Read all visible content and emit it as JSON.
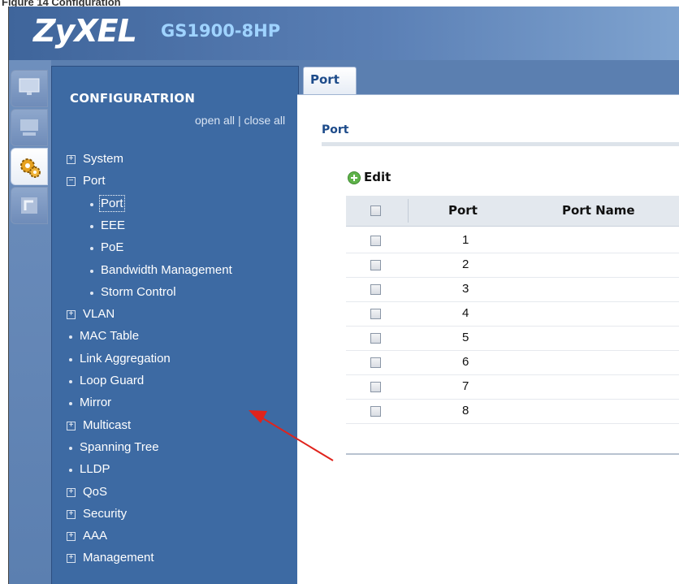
{
  "caption": "Figure 14 Configuration",
  "header": {
    "brand": "ZyXEL",
    "model": "GS1900-8HP"
  },
  "icon_bar": [
    "monitor-icon",
    "status-icon",
    "configuration-gears-icon",
    "maintenance-icon"
  ],
  "sidebar": {
    "title": "CONFIGURATRION",
    "open_all": "open all",
    "divider": "|",
    "close_all": "close all",
    "items": [
      {
        "label": "System",
        "marker": "plus",
        "level": 0
      },
      {
        "label": "Port",
        "marker": "minus",
        "level": 0
      },
      {
        "label": "Port",
        "marker": "dot",
        "level": 1,
        "selected": true
      },
      {
        "label": "EEE",
        "marker": "dot",
        "level": 1
      },
      {
        "label": "PoE",
        "marker": "dot",
        "level": 1
      },
      {
        "label": "Bandwidth Management",
        "marker": "dot",
        "level": 1
      },
      {
        "label": "Storm Control",
        "marker": "dot",
        "level": 1
      },
      {
        "label": "VLAN",
        "marker": "plus",
        "level": 0
      },
      {
        "label": "MAC Table",
        "marker": "dot",
        "level": 0
      },
      {
        "label": "Link Aggregation",
        "marker": "dot",
        "level": 0
      },
      {
        "label": "Loop Guard",
        "marker": "dot",
        "level": 0
      },
      {
        "label": "Mirror",
        "marker": "dot",
        "level": 0
      },
      {
        "label": "Multicast",
        "marker": "plus",
        "level": 0
      },
      {
        "label": "Spanning Tree",
        "marker": "dot",
        "level": 0
      },
      {
        "label": "LLDP",
        "marker": "dot",
        "level": 0
      },
      {
        "label": "QoS",
        "marker": "plus",
        "level": 0
      },
      {
        "label": "Security",
        "marker": "plus",
        "level": 0
      },
      {
        "label": "AAA",
        "marker": "plus",
        "level": 0
      },
      {
        "label": "Management",
        "marker": "plus",
        "level": 0
      }
    ]
  },
  "main": {
    "tab": "Port",
    "section_title": "Port",
    "edit_label": "Edit",
    "columns": [
      "Port",
      "Port Name"
    ],
    "rows": [
      "1",
      "2",
      "3",
      "4",
      "5",
      "6",
      "7",
      "8"
    ]
  },
  "colors": {
    "sidebar_bg": "#3d6aa3",
    "header_bg": "#4f74a9",
    "annotation_arrow": "#e0231c",
    "tab_text": "#1d4b8a"
  }
}
